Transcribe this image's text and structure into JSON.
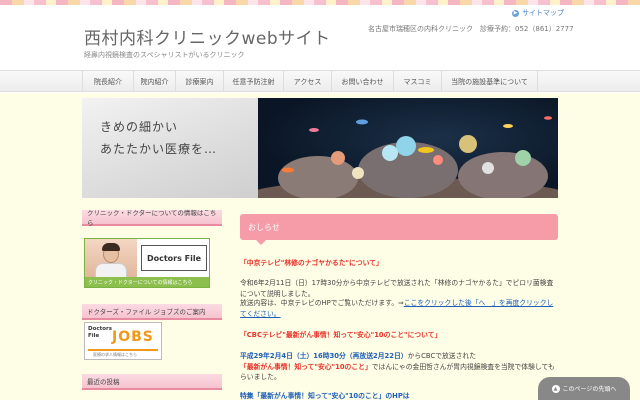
{
  "header": {
    "title": "西村内科クリニックwebサイト",
    "subtitle": "経鼻内視鏡検査のスペシャリストがいるクリニック",
    "sitemap": "サイトマップ",
    "info": "名古屋市瑞穂区の内科クリニック　診療予約：052（861）2777"
  },
  "nav": [
    "院長紹介",
    "院内紹介",
    "診療案内",
    "任意予防注射",
    "アクセス",
    "お問い合わせ",
    "マスコミ",
    "当院の施設基準について"
  ],
  "hero": {
    "line1": "きめの細かい",
    "line2": "あたたかい医療を…"
  },
  "sidebar": {
    "doctor_heading": "クリニック・ドクターについての情報はこちら",
    "df_logo": "Doctors File",
    "df_strip": "クリニック・ドクターについての情報はこちら",
    "jobs_heading": "ドクターズ・ファイル ジョブズのご案内",
    "jobs_small1": "Doctors",
    "jobs_small2": "File",
    "jobs_big": "JOBS",
    "jobs_caption": "医療の求人情報はこちら",
    "recent_heading": "最近の投稿"
  },
  "main": {
    "notice_heading": "おしらせ",
    "post1_title": "「中京テレビ\"林修のナゴヤかるた\"について」",
    "post1_body": "令和6年2月11日（日）17時30分から中京テレビで放送された「林修のナゴヤかるた」でピロリ菌検査について説明しました。",
    "post1_body2": "放送内容は、中京テレビのHPでご覧いただけます。⇒",
    "post1_link": "ここをクリックした後「へ　」を再度クリックしてください。",
    "post2_title": "「CBCテレビ\"最新がん事情！知って\"安心\"10のこと\"について」",
    "post2_date": "平成29年2月4日（土）16時30分（再放送2月22日）",
    "post2_body1": "からCBCで放送された",
    "post2_quote": "「最新がん事情！知って\"安心\"10のこと」",
    "post2_body2": "ではんにゃの金田哲さんが胃内視鏡検査を当院で体験してもらいました。",
    "post3_title": "特集「最新がん事情！知って\"安心\"10のこと」のHPは"
  },
  "float_button": "このページの先頭へ"
}
